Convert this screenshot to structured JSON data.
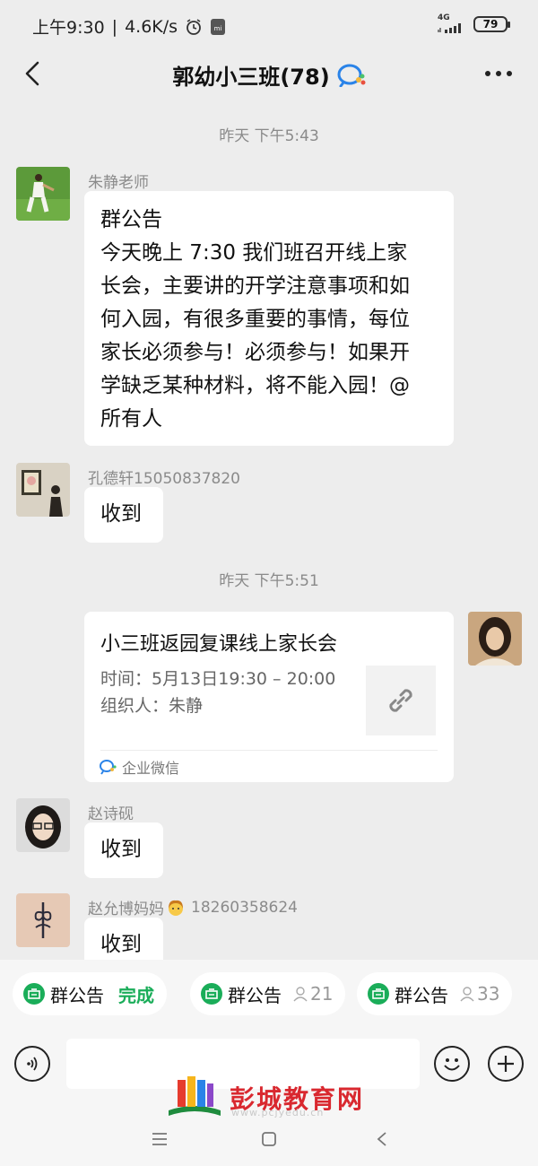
{
  "status_bar": {
    "time": "上午9:30",
    "net_speed": "4.6K/s",
    "network": "4G",
    "battery": "79"
  },
  "header": {
    "title": "郭幼小三班(78)"
  },
  "messages": [
    {
      "time_label": "昨天 下午5:43",
      "sender": "朱静老师",
      "lines": [
        "群公告",
        "今天晚上 7:30 我们班召开线上家",
        "长会，主要讲的开学注意事项和如",
        "何入园，有很多重要的事情，每位",
        "家长必须参与！必须参与！如果开",
        "学缺乏某种材料，将不能入园！@",
        "所有人"
      ]
    },
    {
      "sender": "孔德轩15050837820",
      "text": "收到"
    },
    {
      "time_label": "昨天 下午5:51",
      "card_title": "小三班返园复课线上家长会",
      "card_time": "时间：5月13日19:30 – 20:00",
      "card_organizer": "组织人：朱静",
      "card_source": "企业微信"
    },
    {
      "sender": "赵诗砚",
      "text": "收到"
    },
    {
      "sender": "赵允博妈妈",
      "sender_phone": "18260358624",
      "text": "收到"
    }
  ],
  "notice_chips": [
    {
      "label": "群公告",
      "status": "完成"
    },
    {
      "label": "群公告",
      "count": "21"
    },
    {
      "label": "群公告",
      "count": "33"
    }
  ],
  "watermark": {
    "text": "彭城教育网",
    "sub": "www.pcjyedu.cn"
  },
  "colors": {
    "accent_green": "#1aad59",
    "page_bg": "#ededed",
    "watermark_red": "#d9282f"
  }
}
